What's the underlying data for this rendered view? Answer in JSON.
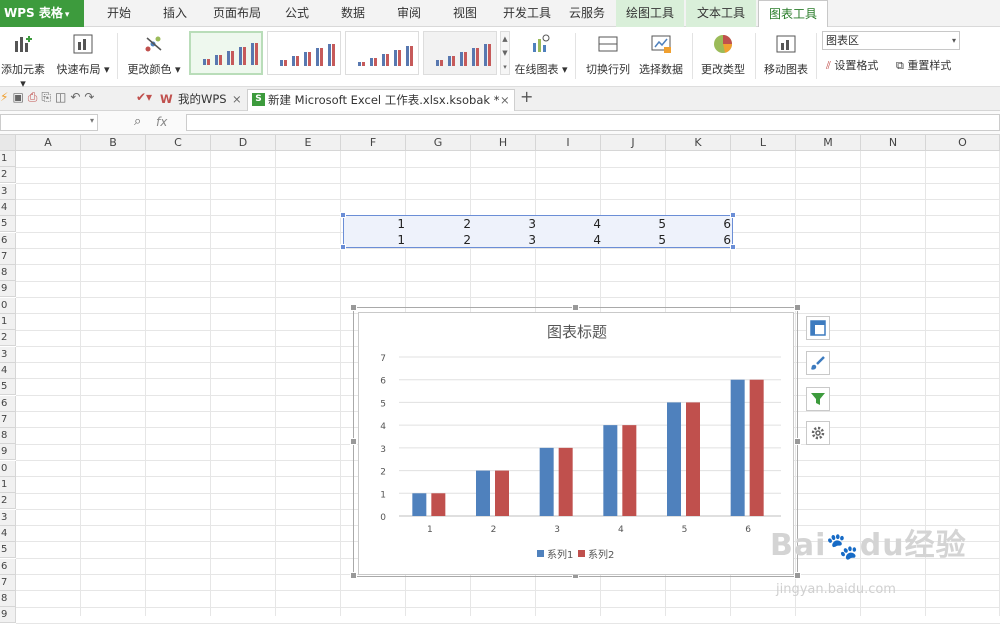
{
  "app": {
    "name": "WPS 表格",
    "brand_color": "#3d9b3d"
  },
  "menu_tabs": [
    {
      "label": "开始"
    },
    {
      "label": "插入"
    },
    {
      "label": "页面布局"
    },
    {
      "label": "公式"
    },
    {
      "label": "数据"
    },
    {
      "label": "审阅"
    },
    {
      "label": "视图"
    },
    {
      "label": "开发工具"
    },
    {
      "label": "云服务"
    },
    {
      "label": "绘图工具"
    },
    {
      "label": "文本工具"
    },
    {
      "label": "图表工具"
    }
  ],
  "ribbon": {
    "add_element": "添加元素",
    "quick_layout": "快速布局",
    "change_color": "更改颜色",
    "online_chart": "在线图表",
    "switch_row_col": "切换行列",
    "select_data": "选择数据",
    "change_type": "更改类型",
    "move_chart": "移动图表",
    "chart_area_select": "图表区",
    "set_format": "设置格式",
    "reset_style": "重置样式"
  },
  "doc_tabs": {
    "my_wps": "我的WPS",
    "file_tab": "新建 Microsoft Excel 工作表.xlsx.ksobak *",
    "add": "+"
  },
  "formula_bar": {
    "fx": "fx",
    "name_box": "",
    "content": ""
  },
  "columns": [
    "A",
    "B",
    "C",
    "D",
    "E",
    "F",
    "G",
    "H",
    "I",
    "J",
    "K",
    "L",
    "M",
    "N",
    "O"
  ],
  "row_numbers": [
    "1",
    "2",
    "3",
    "4",
    "5",
    "6",
    "7",
    "8",
    "9",
    "0",
    "1",
    "2",
    "3",
    "4",
    "5",
    "6",
    "7",
    "8",
    "9",
    "0",
    "1",
    "2",
    "3",
    "4",
    "5",
    "6",
    "7",
    "8",
    "9"
  ],
  "cells": {
    "row5": [
      "1",
      "2",
      "3",
      "4",
      "5",
      "6"
    ],
    "row6": [
      "1",
      "2",
      "3",
      "4",
      "5",
      "6"
    ]
  },
  "chart_data": {
    "type": "bar",
    "title": "图表标题",
    "categories": [
      "1",
      "2",
      "3",
      "4",
      "5",
      "6"
    ],
    "series": [
      {
        "name": "系列1",
        "values": [
          1,
          2,
          3,
          4,
          5,
          6
        ],
        "color": "#4f81bd"
      },
      {
        "name": "系列2",
        "values": [
          1,
          2,
          3,
          4,
          5,
          6
        ],
        "color": "#c0504d"
      }
    ],
    "ylim": [
      0,
      7
    ],
    "yticks": [
      "0",
      "1",
      "2",
      "3",
      "4",
      "5",
      "6",
      "7"
    ],
    "grid": true,
    "legend": "bottom"
  },
  "watermark": "Baidu经验 jingyan.baidu.com"
}
